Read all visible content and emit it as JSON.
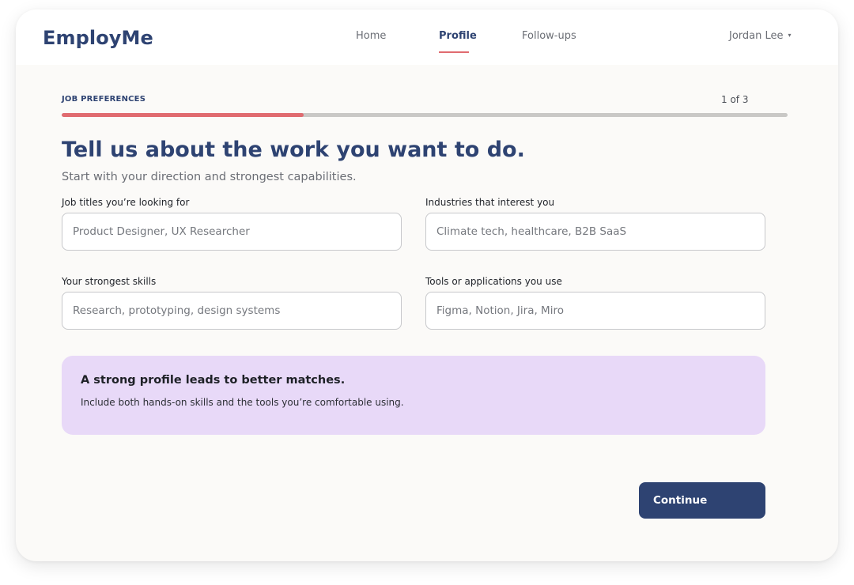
{
  "app": {
    "brand": "EmployMe"
  },
  "nav": {
    "items": [
      {
        "label": "Home",
        "active": false
      },
      {
        "label": "Profile",
        "active": true
      },
      {
        "label": "Follow-ups",
        "active": false
      }
    ],
    "user": {
      "name": "Jordan Lee",
      "caret": "▾"
    }
  },
  "progress": {
    "section": "JOB PREFERENCES",
    "step_text": "1 of 3",
    "fraction_complete": 0.333,
    "fill_color": "#e06b70",
    "track_color": "#c9c8c6"
  },
  "header": {
    "title": "Tell us about the work you want to do.",
    "subtitle": "Start with your direction and strongest capabilities."
  },
  "form": {
    "fields": [
      {
        "label": "Job titles you’re looking for",
        "value": "",
        "placeholder": "Product Designer, UX Researcher"
      },
      {
        "label": "Industries that interest you",
        "value": "",
        "placeholder": "Climate tech, healthcare, B2B SaaS"
      },
      {
        "label": "Your strongest skills",
        "value": "",
        "placeholder": "Research, prototyping, design systems"
      },
      {
        "label": "Tools or applications you use",
        "value": "",
        "placeholder": "Figma, Notion, Jira, Miro"
      }
    ]
  },
  "tip": {
    "title": "A strong profile leads to better matches.",
    "body": "Include both hands-on skills and the tools you’re comfortable using."
  },
  "actions": {
    "continue_label": "Continue"
  },
  "colors": {
    "brand": "#2e4372",
    "accent": "#e06b70",
    "tip_background": "#e8d9f8",
    "page_background": "#fbfaf8"
  }
}
